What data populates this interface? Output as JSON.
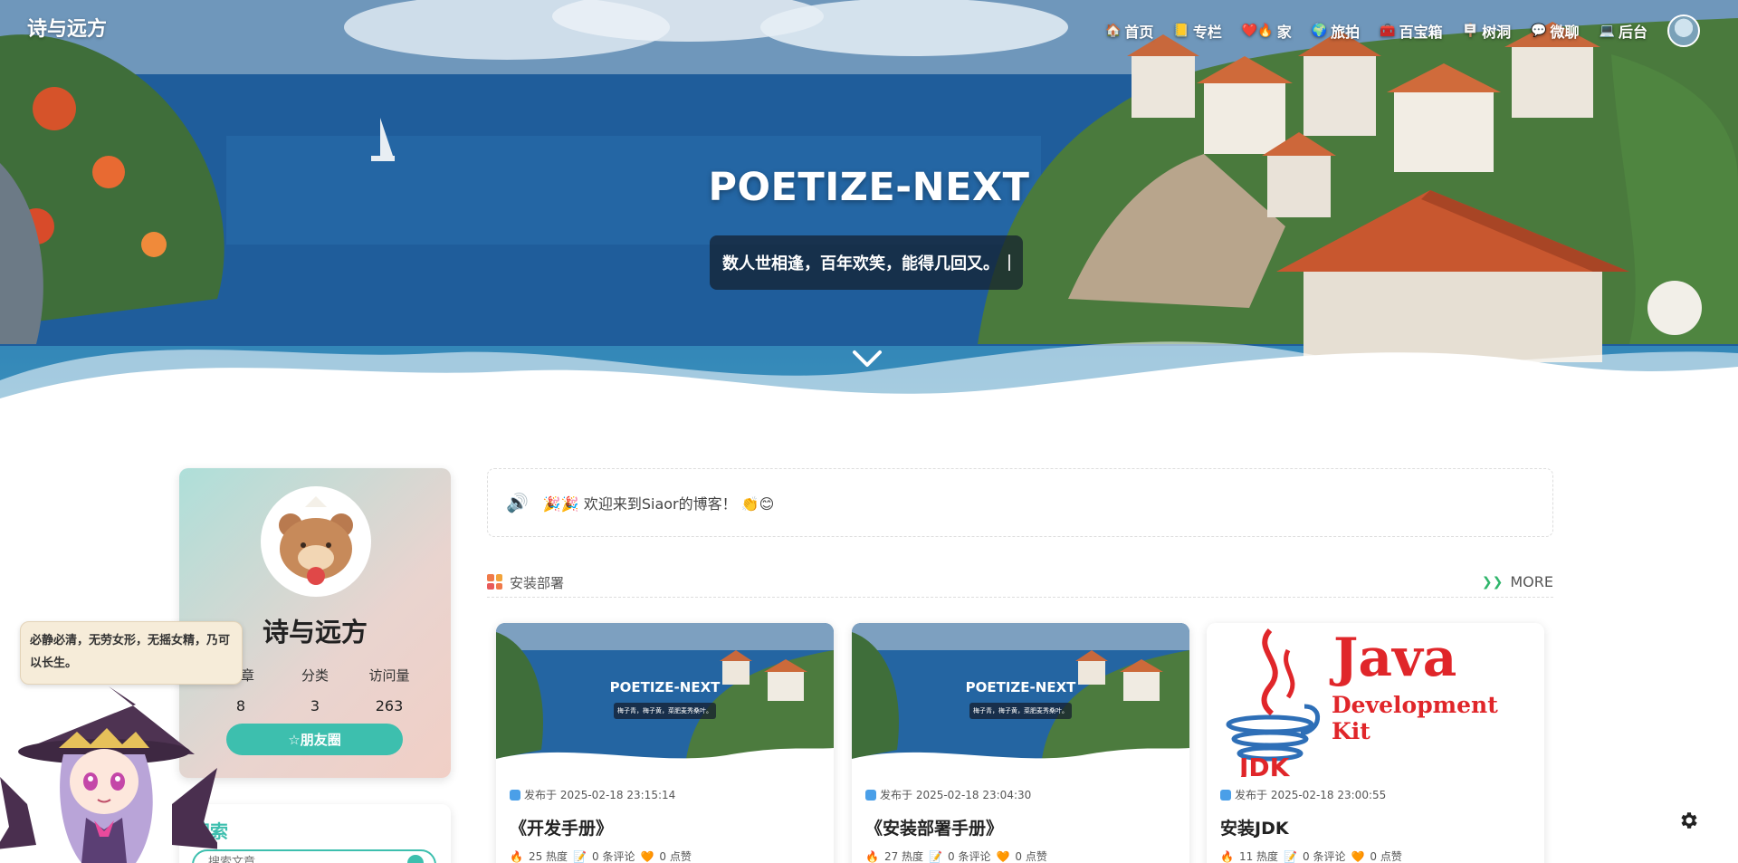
{
  "site": {
    "title": "诗与远方"
  },
  "nav": [
    {
      "label": "首页",
      "icon": "🏠"
    },
    {
      "label": "专栏",
      "icon": "📒"
    },
    {
      "label": "家",
      "icon": "❤️🔥"
    },
    {
      "label": "旅拍",
      "icon": "🌍"
    },
    {
      "label": "百宝箱",
      "icon": "🧰"
    },
    {
      "label": "树洞",
      "icon": "🪧"
    },
    {
      "label": "微聊",
      "icon": "💬"
    },
    {
      "label": "后台",
      "icon": "💻"
    }
  ],
  "hero": {
    "heading": "POETIZE-NEXT",
    "quote": "数人世相逢，百年欢笑，能得几回又。"
  },
  "profile": {
    "name": "诗与远方",
    "stats": [
      {
        "label": "文章",
        "value": "8"
      },
      {
        "label": "分类",
        "value": "3"
      },
      {
        "label": "访问量",
        "value": "263"
      }
    ],
    "friends_button": "☆朋友圈"
  },
  "search": {
    "title": "搜索",
    "placeholder": "搜索文章"
  },
  "mascot": {
    "speech": "必静必清，无劳女形，无摇女精，乃可以长生。"
  },
  "notice": {
    "text": "🎉🎉 欢迎来到Siaor的博客！ 👏😊"
  },
  "section": {
    "title": "安装部署",
    "more": "MORE"
  },
  "posts": [
    {
      "date": "发布于 2025-02-18 23:15:14",
      "title": "《开发手册》",
      "heat": "25 热度",
      "comments": "0 条评论",
      "likes": "0 点赞",
      "thumb_heading": "POETIZE-NEXT",
      "thumb_quote": "梅子青，梅子黄，菜肥麦秀桑叶。"
    },
    {
      "date": "发布于 2025-02-18 23:04:30",
      "title": "《安装部署手册》",
      "heat": "27 热度",
      "comments": "0 条评论",
      "likes": "0 点赞",
      "thumb_heading": "POETIZE-NEXT",
      "thumb_quote": "梅子青，梅子黄，菜肥麦秀桑叶。"
    },
    {
      "date": "发布于 2025-02-18 23:00:55",
      "title": "安装JDK",
      "heat": "11 热度",
      "comments": "0 条评论",
      "likes": "0 点赞",
      "thumb_java": "Java",
      "thumb_kit": "Development Kit",
      "thumb_jdk": "JDK"
    }
  ],
  "colors": {
    "accent": "#3dbfae",
    "link_blue": "#4a9fe8",
    "java_red": "#e0262a",
    "java_blue": "#2e6fb7"
  }
}
